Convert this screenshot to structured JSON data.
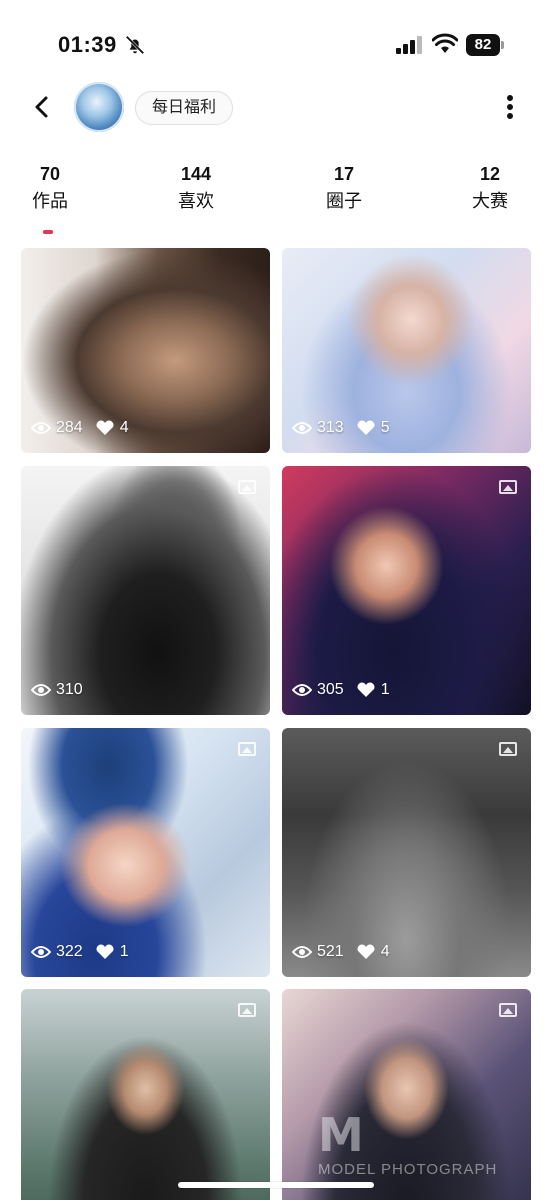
{
  "status_bar": {
    "time": "01:39",
    "battery": "82",
    "icons": [
      "bell-slash-icon",
      "signal-icon",
      "wifi-icon",
      "battery-icon"
    ]
  },
  "header": {
    "back_icon": "chevron-left-icon",
    "username": "每日福利",
    "more_icon": "more-vertical-icon"
  },
  "stats": [
    {
      "count": "70",
      "label": "作品"
    },
    {
      "count": "144",
      "label": "喜欢"
    },
    {
      "count": "17",
      "label": "圈子"
    },
    {
      "count": "12",
      "label": "大赛"
    }
  ],
  "accent_color": "#e8315b",
  "posts": [
    {
      "views": "284",
      "likes": "4",
      "has_image_icon": false
    },
    {
      "views": "313",
      "likes": "5",
      "has_image_icon": false
    },
    {
      "views": "310",
      "likes": "",
      "has_image_icon": true
    },
    {
      "views": "305",
      "likes": "1",
      "has_image_icon": true
    },
    {
      "views": "322",
      "likes": "1",
      "has_image_icon": true
    },
    {
      "views": "521",
      "likes": "4",
      "has_image_icon": true
    },
    {
      "views": "",
      "likes": "",
      "has_image_icon": true
    },
    {
      "views": "",
      "likes": "",
      "has_image_icon": true
    }
  ],
  "watermark": {
    "logo": "M",
    "sub": "MODEL PHOTOGRAPH"
  }
}
